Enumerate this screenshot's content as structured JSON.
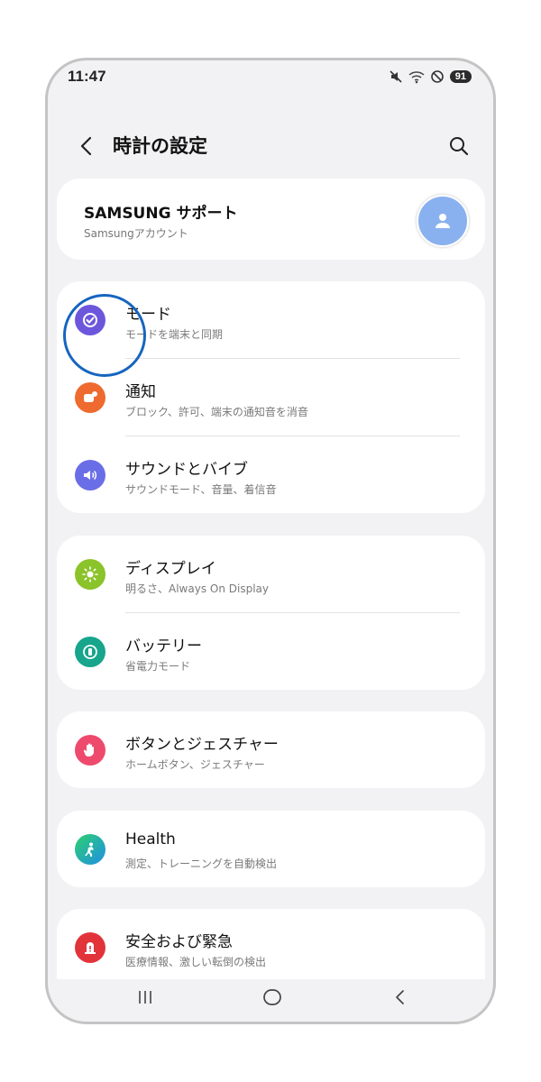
{
  "status_bar": {
    "time": "11:47",
    "battery": "91"
  },
  "app_bar": {
    "title": "時計の設定"
  },
  "account": {
    "name": "SAMSUNG サポート",
    "subtitle": "Samsungアカウント"
  },
  "groups": {
    "group1": [
      {
        "title": "モード",
        "subtitle": "モードを端末と同期",
        "icon": "mode-check-icon",
        "color": "#6c57dc"
      },
      {
        "title": "通知",
        "subtitle": "ブロック、許可、端末の通知音を消音",
        "icon": "notification-icon",
        "color": "#ef6a2e"
      },
      {
        "title": "サウンドとバイブ",
        "subtitle": "サウンドモード、音量、着信音",
        "icon": "sound-icon",
        "color": "#6a6ee6"
      }
    ],
    "group2": [
      {
        "title": "ディスプレイ",
        "subtitle": "明るさ、Always On Display",
        "icon": "brightness-icon",
        "color": "#8bc32a"
      },
      {
        "title": "バッテリー",
        "subtitle": "省電力モード",
        "icon": "battery-icon",
        "color": "#17a58c"
      }
    ],
    "group3": [
      {
        "title": "ボタンとジェスチャー",
        "subtitle": "ホームボタン、ジェスチャー",
        "icon": "hand-icon",
        "color": "#ee4a6d"
      }
    ],
    "group4": [
      {
        "title": "Health",
        "subtitle": "測定、トレーニングを自動検出",
        "icon": "health-icon",
        "color": "#1fa8d8"
      }
    ],
    "group5": [
      {
        "title": "安全および緊急",
        "subtitle": "医療情報、激しい転倒の検出",
        "icon": "emergency-icon",
        "color": "#e2333b"
      }
    ]
  }
}
